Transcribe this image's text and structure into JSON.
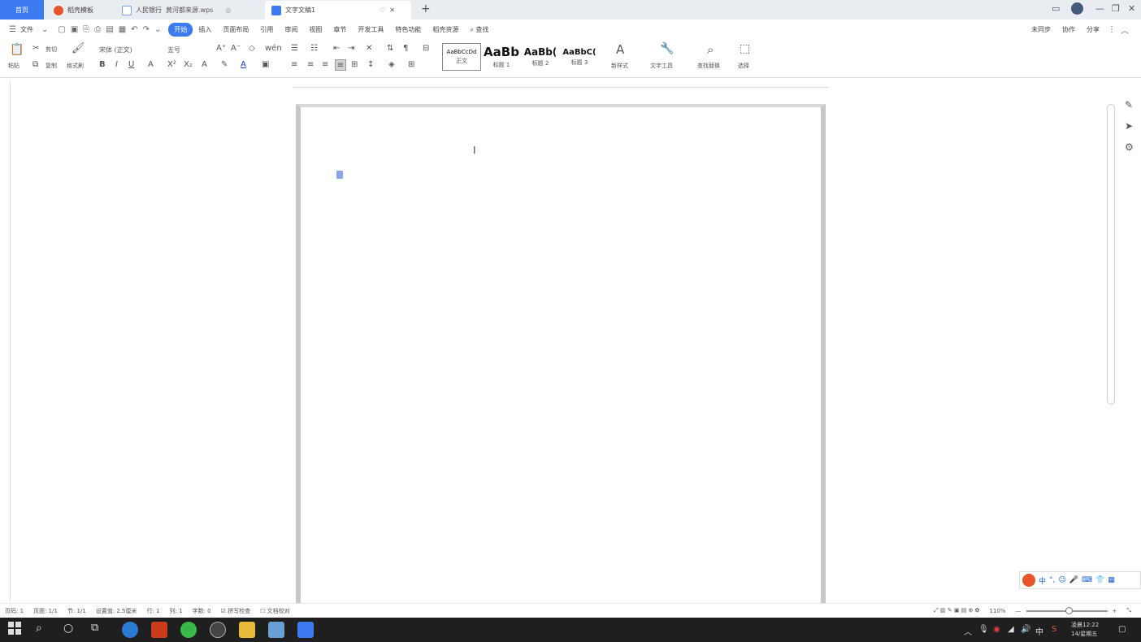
{
  "tabs": [
    {
      "label": "首页"
    },
    {
      "label": "稻壳模板"
    },
    {
      "label": "人民银行",
      "sub": "黄河都来源.wps"
    },
    {
      "label": "文字文稿1"
    }
  ],
  "menu": {
    "file": "文件",
    "items": [
      "开始",
      "插入",
      "页面布局",
      "引用",
      "审阅",
      "视图",
      "章节",
      "开发工具",
      "特色功能",
      "稻壳资源"
    ],
    "search": "查找",
    "right": [
      "未同步",
      "协作",
      "分享"
    ]
  },
  "ribbon": {
    "paste": "粘贴",
    "cut": "剪切",
    "copy": "复制",
    "format_painter": "格式刷",
    "font_name": "宋体 (正文)",
    "font_size": "五号",
    "styles": [
      {
        "preview": "AaBbCcDd",
        "name": "正文"
      },
      {
        "preview": "AaBb",
        "name": "标题 1"
      },
      {
        "preview": "AaBb(",
        "name": "标题 2"
      },
      {
        "preview": "AaBbC(",
        "name": "标题 3"
      }
    ],
    "new_style": "新样式",
    "text_tools": "文字工具",
    "find_replace": "查找替换",
    "select": "选择"
  },
  "status": {
    "page": "页码: 1",
    "pages": "页面: 1/1",
    "section": "节: 1/1",
    "setting": "设置值: 2.5厘米",
    "row": "行: 1",
    "col": "列: 1",
    "words": "字数: 0",
    "spell": "拼写检查",
    "doc_check": "文档校对",
    "zoom": "110%"
  },
  "taskbar": {
    "clock_time": "凌晨12:22",
    "clock_day": "14/星期五",
    "lang": "中"
  },
  "colors": {
    "accent": "#3d7bf0",
    "taskbar": "#1f1f1f",
    "tabbar": "#e9ecf1"
  }
}
